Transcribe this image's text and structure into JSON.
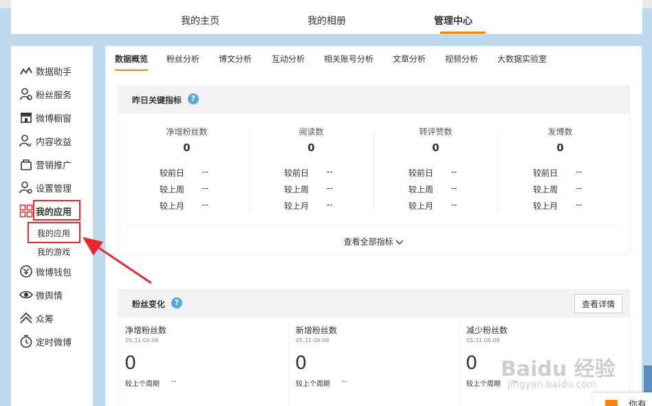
{
  "top_nav": {
    "tabs": [
      {
        "label": "我的主页"
      },
      {
        "label": "我的相册"
      },
      {
        "label": "管理中心",
        "active": true
      }
    ]
  },
  "sidebar": {
    "items": [
      {
        "label": "数据助手",
        "icon": "chart-line-icon"
      },
      {
        "label": "粉丝服务",
        "icon": "fans-service-icon"
      },
      {
        "label": "微博橱窗",
        "icon": "shop-window-icon"
      },
      {
        "label": "内容收益",
        "icon": "content-income-icon"
      },
      {
        "label": "营销推广",
        "icon": "bag-icon"
      },
      {
        "label": "设置管理",
        "icon": "settings-user-icon"
      },
      {
        "label": "我的应用",
        "icon": "grid-apps-icon",
        "active": true
      },
      {
        "label": "微博钱包",
        "icon": "wallet-icon"
      },
      {
        "label": "微舆情",
        "icon": "eye-icon"
      },
      {
        "label": "众筹",
        "icon": "crowdfund-icon"
      },
      {
        "label": "定时微博",
        "icon": "clock-icon"
      }
    ],
    "sub_items": [
      {
        "label": "我的应用"
      },
      {
        "label": "我的游戏"
      }
    ]
  },
  "sub_tabs": [
    {
      "label": "数据概览",
      "active": true
    },
    {
      "label": "粉丝分析"
    },
    {
      "label": "博文分析"
    },
    {
      "label": "互动分析"
    },
    {
      "label": "相关账号分析"
    },
    {
      "label": "文章分析"
    },
    {
      "label": "视频分析"
    },
    {
      "label": "大数据实验室"
    }
  ],
  "key_metrics": {
    "title": "昨日关键指标",
    "help": "?",
    "compare_labels": [
      "较前日",
      "较上周",
      "较上月"
    ],
    "metrics": [
      {
        "name": "净增粉丝数",
        "value": "0",
        "compares": [
          "--",
          "--",
          "--"
        ]
      },
      {
        "name": "阅读数",
        "value": "0",
        "compares": [
          "--",
          "--",
          "--"
        ]
      },
      {
        "name": "转评赞数",
        "value": "0",
        "compares": [
          "--",
          "--",
          "--"
        ]
      },
      {
        "name": "发博数",
        "value": "0",
        "compares": [
          "--",
          "--",
          "--"
        ]
      }
    ],
    "view_all": "查看全部指标",
    "view_all_icon": "chevron-down-icon"
  },
  "fans_change": {
    "title": "粉丝变化",
    "help": "?",
    "detail_button": "查看详情",
    "columns": [
      {
        "name": "净增粉丝数",
        "date": "05.31-06.06",
        "value": "0",
        "cmp_label": "较上个周期",
        "cmp_value": "--"
      },
      {
        "name": "新增粉丝数",
        "date": "05.31-06.06",
        "value": "0",
        "cmp_label": "较上个周期",
        "cmp_value": "--"
      },
      {
        "name": "减少粉丝数",
        "date": "05.31-06.06",
        "value": "0",
        "cmp_label": "较上个周期",
        "cmp_value": "--"
      }
    ]
  },
  "floating": {
    "text": "你有"
  },
  "watermark": {
    "brand": "Baidu 经验",
    "url": "jingyan.baidu.com"
  },
  "colors": {
    "accent": "#ff8200",
    "highlight": "#e8282b",
    "help": "#5aa8d9",
    "page_bg": "#bfd9ec"
  }
}
